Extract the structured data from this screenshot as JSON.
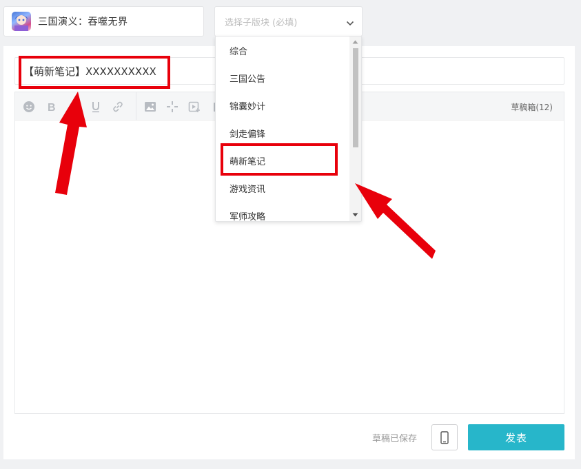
{
  "header": {
    "game_name": "三国演义：吞噬无界",
    "subforum_placeholder": "选择子版块 (必填)"
  },
  "title_field": {
    "value": "【萌新笔记】XXXXXXXXXX"
  },
  "toolbar": {
    "drafts_label": "草稿箱(12)"
  },
  "dropdown": {
    "items": [
      "综合",
      "三国公告",
      "锦囊妙计",
      "剑走偏锋",
      "萌新笔记",
      "游戏资讯",
      "军师攻略"
    ],
    "highlighted_index": 4
  },
  "footer": {
    "saved_text": "草稿已保存",
    "publish_label": "发表"
  },
  "colors": {
    "accent": "#27b6ca",
    "annotation": "#e8000b"
  }
}
